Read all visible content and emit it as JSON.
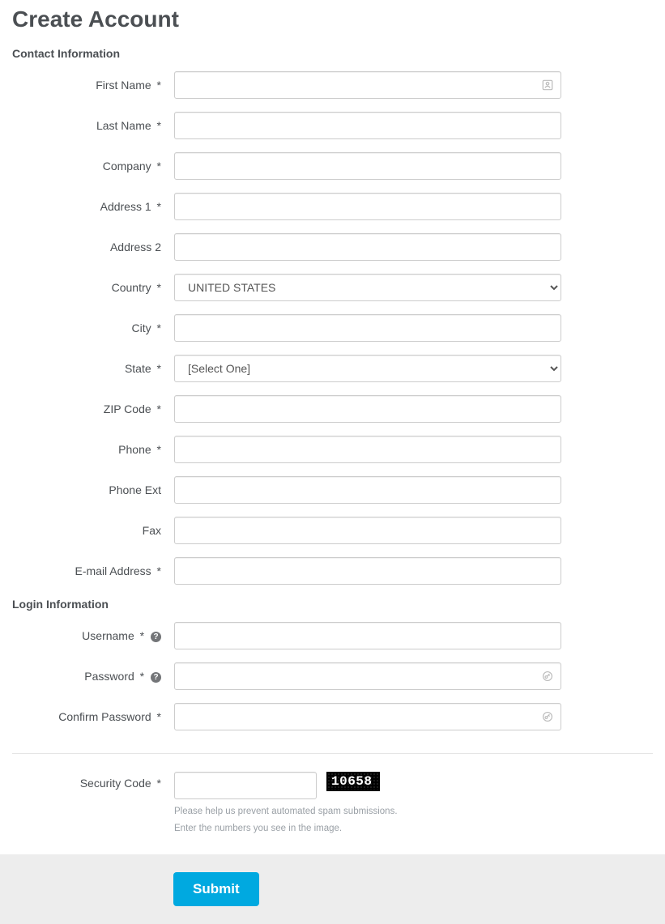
{
  "page": {
    "title": "Create Account"
  },
  "sections": {
    "contact": {
      "heading": "Contact Information"
    },
    "login": {
      "heading": "Login Information"
    }
  },
  "fields": {
    "first_name": {
      "label": "First Name",
      "required": true
    },
    "last_name": {
      "label": "Last Name",
      "required": true
    },
    "company": {
      "label": "Company",
      "required": true
    },
    "address1": {
      "label": "Address 1",
      "required": true
    },
    "address2": {
      "label": "Address 2",
      "required": false
    },
    "country": {
      "label": "Country",
      "required": true
    },
    "city": {
      "label": "City",
      "required": true
    },
    "state": {
      "label": "State",
      "required": true
    },
    "zip": {
      "label": "ZIP Code",
      "required": true
    },
    "phone": {
      "label": "Phone",
      "required": true
    },
    "phone_ext": {
      "label": "Phone Ext",
      "required": false
    },
    "fax": {
      "label": "Fax",
      "required": false
    },
    "email": {
      "label": "E-mail Address",
      "required": true
    },
    "username": {
      "label": "Username",
      "required": true
    },
    "password": {
      "label": "Password",
      "required": true
    },
    "confirm_password": {
      "label": "Confirm Password",
      "required": true
    },
    "security_code": {
      "label": "Security Code",
      "required": true
    }
  },
  "selects": {
    "country": {
      "value": "UNITED STATES"
    },
    "state": {
      "value": "[Select One]"
    }
  },
  "captcha": {
    "code": "10658",
    "hint1": "Please help us prevent automated spam submissions.",
    "hint2": "Enter the numbers you see in the image."
  },
  "required_mark": "*",
  "help_glyph": "?",
  "submit": {
    "label": "Submit"
  }
}
